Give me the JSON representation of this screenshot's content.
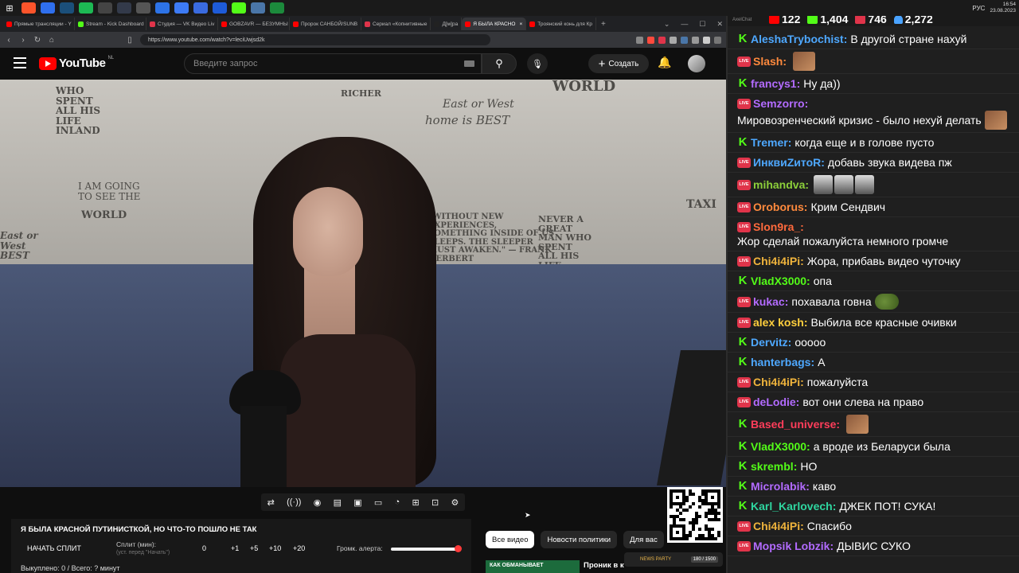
{
  "taskbar": {
    "clock_time": "16:54",
    "clock_date": "23.08.2023",
    "lang": "РУС",
    "icons": [
      {
        "name": "windows-start",
        "color": "#ffffff"
      },
      {
        "name": "brave-browser",
        "color": "#fb542b"
      },
      {
        "name": "app-blue",
        "color": "#2f6fed"
      },
      {
        "name": "steam",
        "color": "#1b4f7a"
      },
      {
        "name": "spotify",
        "color": "#1db954"
      },
      {
        "name": "app-chrome",
        "color": "#444444"
      },
      {
        "name": "obs",
        "color": "#333a4a"
      },
      {
        "name": "app-grid",
        "color": "#555555"
      },
      {
        "name": "app-blue-2",
        "color": "#2d73e6"
      },
      {
        "name": "app-arrow",
        "color": "#3d7bf5"
      },
      {
        "name": "app-chat",
        "color": "#3a6be0"
      },
      {
        "name": "app-play",
        "color": "#1e5bd8"
      },
      {
        "name": "kick-app",
        "color": "#53fc18"
      },
      {
        "name": "app-vk",
        "color": "#4a76a8"
      },
      {
        "name": "app-green",
        "color": "#1c8a3c"
      }
    ]
  },
  "browser": {
    "tabs": [
      {
        "label": "Прямые трансляции - Y",
        "color": "#ff0000",
        "active": false
      },
      {
        "label": "Stream - Kick Dashboard",
        "color": "#53fc18",
        "active": false
      },
      {
        "label": "Студия — VK Видео Liv",
        "color": "#e0344a",
        "active": false
      },
      {
        "label": "GOBZAVR — БЕЗУМНЫ",
        "color": "#ff0000",
        "active": false
      },
      {
        "label": "Пророк САНБОЙ/SUNB",
        "color": "#ff0000",
        "active": false
      },
      {
        "label": "Сериал «Копнитивные",
        "color": "#e0344a",
        "active": false
      },
      {
        "label": "Д[м]ра",
        "color": "#222222",
        "active": false
      },
      {
        "label": "Я БЫЛА КРАСНО",
        "color": "#ff0000",
        "active": true
      },
      {
        "label": "Троянский конь для Кр",
        "color": "#ff0000",
        "active": false
      }
    ],
    "url": "https://www.youtube.com/watch?v=leciUwjsd2k"
  },
  "youtube": {
    "logo_text": "YouTube",
    "country": "NL",
    "search_placeholder": "Введите запрос",
    "create_label": "Создать"
  },
  "video": {
    "wall_texts": [
      "WORLD",
      "East or West",
      "home is BEST",
      "I AM GOING TO SEE THE",
      "WORLD",
      "\"WITHOUT NEW EXPERIENCES, SOMETHING INSIDE OF US SLEEPS. THE SLEEPER MUST AWAKEN.\" — FRANK HERBERT",
      "NEVER A GREAT MAN WHO SPENT ALL HIS LIFE",
      "TAXI",
      "East or West BEST",
      "WHO SPENT ALL HIS LIFE INLAND",
      "RICHER"
    ]
  },
  "overlay": {
    "title": "Я БЫЛА КРАСНОЙ ПУТИНИСТКОЙ, НО ЧТО-ТО ПОШЛО НЕ ТАК",
    "split_button": "НАЧАТЬ СПЛИТ",
    "split_label": "Сплит (мин):",
    "split_hint": "(уст. перед \"Начать\")",
    "split_value": "0",
    "increments": [
      "+1",
      "+5",
      "+10",
      "+20"
    ],
    "alert_label": "Громк. алерта:",
    "alert_volume": 0.99,
    "stats": "Выкуплено: 0 / Всего: ? минут"
  },
  "control_icons": [
    "loop-icon",
    "broadcast-icon",
    "camera-eye-icon",
    "clapper-icon",
    "frame-icon",
    "theater-icon",
    "speed-icon",
    "add-clip-icon",
    "screenshot-icon",
    "settings-icon"
  ],
  "chips": [
    "Все видео",
    "Новости политики",
    "Для вас"
  ],
  "suggestion": {
    "thumb_text": "КАК ОБМАНЫВАЕТ",
    "title": "Проник в к"
  },
  "party_badge": {
    "label": "NEWS PARTY",
    "count": "180 / 1500"
  },
  "chat": {
    "app_name": "AxelChat",
    "counters": [
      {
        "icon": "youtube-icon",
        "color": "#ff0000",
        "value": "122"
      },
      {
        "icon": "kick-icon",
        "color": "#53fc18",
        "value": "1,404"
      },
      {
        "icon": "vk-live-icon",
        "color": "#e0344a",
        "value": "746"
      },
      {
        "icon": "viewers-icon",
        "color": "#4aa3ff",
        "value": "2,272"
      }
    ],
    "messages": [
      {
        "platform": "kick",
        "nick": "AleshaTrybochist:",
        "color": "#4ea8ff",
        "text": "В другой стране нахуй",
        "emote": ""
      },
      {
        "platform": "vk",
        "nick": "Slash:",
        "color": "#ff8a3d",
        "text": "",
        "emote": "face"
      },
      {
        "platform": "kick",
        "nick": "francys1:",
        "color": "#b36bff",
        "text": "Ну да))",
        "emote": ""
      },
      {
        "platform": "vk",
        "nick": "Semzorro:",
        "color": "#b36bff",
        "text": "Мировозренческий кризис - было нехуй делать",
        "emote": "face"
      },
      {
        "platform": "kick",
        "nick": "Tremer:",
        "color": "#4ea8ff",
        "text": "когда еще и в голове пусто",
        "emote": ""
      },
      {
        "platform": "vk",
        "nick": "ИнквиZитоR:",
        "color": "#4ea8ff",
        "text": "добавь звука видева пж",
        "emote": ""
      },
      {
        "platform": "vk",
        "nick": "mihandva:",
        "color": "#8ccf3a",
        "text": "",
        "emote": "trio"
      },
      {
        "platform": "vk",
        "nick": "Oroborus:",
        "color": "#ff8a3d",
        "text": "Крим Сендвич",
        "emote": ""
      },
      {
        "platform": "vk",
        "nick": "Slon9ra_:",
        "color": "#ff6a3d",
        "text": "Жор сделай пожалуйста немного громче",
        "emote": ""
      },
      {
        "platform": "vk",
        "nick": "Chi4i4iPi:",
        "color": "#f0b43c",
        "text": "Жора, прибавь видео чуточку",
        "emote": ""
      },
      {
        "platform": "kick",
        "nick": "VladX3000:",
        "color": "#53fc18",
        "text": "опа",
        "emote": ""
      },
      {
        "platform": "vk",
        "nick": "kukac:",
        "color": "#b36bff",
        "text": "похавала говна",
        "emote": "pepe"
      },
      {
        "platform": "vk",
        "nick": "alex kosh:",
        "color": "#ffcf3d",
        "text": "Выбила все красные очивки",
        "emote": ""
      },
      {
        "platform": "kick",
        "nick": "Dervitz:",
        "color": "#4ea8ff",
        "text": "ооооо",
        "emote": ""
      },
      {
        "platform": "kick",
        "nick": "hanterbags:",
        "color": "#4ea8ff",
        "text": "А",
        "emote": ""
      },
      {
        "platform": "vk",
        "nick": "Chi4i4iPi:",
        "color": "#f0b43c",
        "text": "пожалуйста",
        "emote": ""
      },
      {
        "platform": "vk",
        "nick": "deLodie:",
        "color": "#b36bff",
        "text": "вот они слева на право",
        "emote": ""
      },
      {
        "platform": "kick",
        "nick": "Based_universe:",
        "color": "#ff3d5a",
        "text": "",
        "emote": "face"
      },
      {
        "platform": "kick",
        "nick": "VladX3000:",
        "color": "#53fc18",
        "text": "а вроде из Беларуси была",
        "emote": ""
      },
      {
        "platform": "kick",
        "nick": "skrembl:",
        "color": "#53fc18",
        "text": "НО",
        "emote": ""
      },
      {
        "platform": "kick",
        "nick": "Microlabik:",
        "color": "#b36bff",
        "text": "каво",
        "emote": ""
      },
      {
        "platform": "kick",
        "nick": "Karl_Karlovech:",
        "color": "#2fd6a0",
        "text": "ДЖЕК ПОТ! СУКА!",
        "emote": ""
      },
      {
        "platform": "vk",
        "nick": "Chi4i4iPi:",
        "color": "#f0b43c",
        "text": "Спасибо",
        "emote": ""
      },
      {
        "platform": "vk",
        "nick": "Mopsik Lobzik:",
        "color": "#b36bff",
        "text": "ДЫВИС СУКО",
        "emote": ""
      }
    ]
  }
}
